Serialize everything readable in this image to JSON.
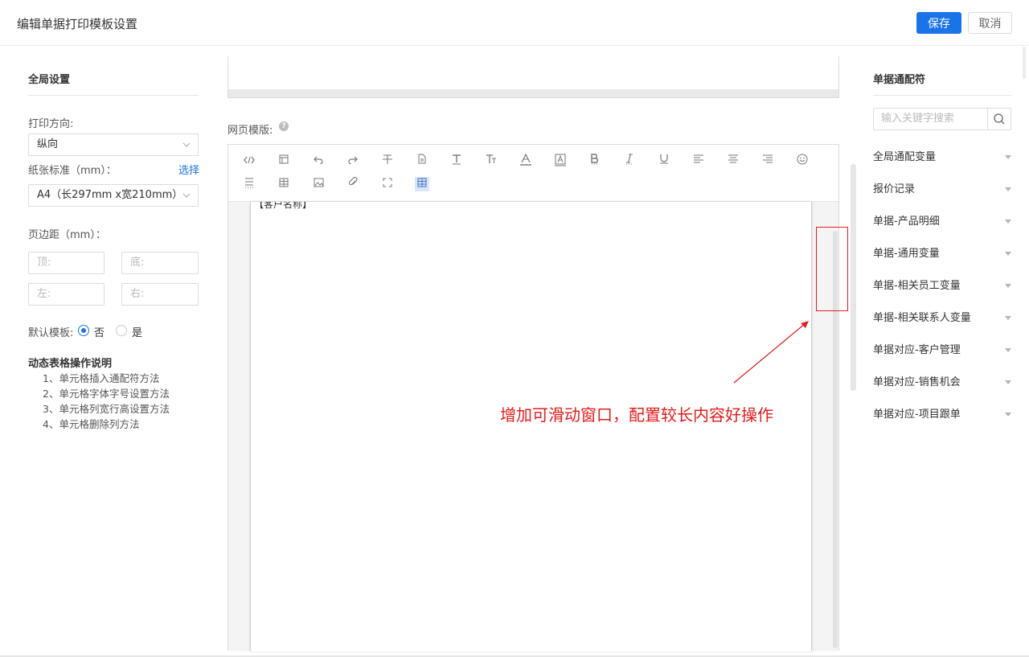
{
  "header": {
    "title": "编辑单据打印模板设置",
    "save_label": "保存",
    "cancel_label": "取消"
  },
  "left": {
    "section_title": "全局设置",
    "orientation_label": "打印方向:",
    "orientation_value": "纵向",
    "paper_label": "纸张标准（mm）：",
    "paper_select_link": "选择",
    "paper_value": "A4（长297mm x宽210mm）",
    "margin_label": "页边距（mm）：",
    "margin_top_placeholder": "顶:",
    "margin_bottom_placeholder": "底:",
    "margin_left_placeholder": "左:",
    "margin_right_placeholder": "右:",
    "default_template_label": "默认模板:",
    "radio_no": "否",
    "radio_yes": "是",
    "help_title": "动态表格操作说明",
    "help_items": [
      "1、单元格插入通配符方法",
      "2、单元格字体字号设置方法",
      "3、单元格列宽行高设置方法",
      "4、单元格删除列方法"
    ]
  },
  "middle": {
    "web_template_label": "网页模版:",
    "doc_text": "【客户名称】",
    "annotation": "增加可滑动窗口，配置较长内容好操作"
  },
  "right": {
    "section_title": "单据通配符",
    "search_placeholder": "输入关键字搜索",
    "items": [
      "全局通配变量",
      "报价记录",
      "单据-产品明细",
      "单据-通用变量",
      "单据-相关员工变量",
      "单据-相关联系人变量",
      "单据对应-客户管理",
      "单据对应-销售机会",
      "单据对应-项目跟单"
    ]
  },
  "colors": {
    "accent": "#1a73e8",
    "annotation": "#e41b1b"
  }
}
